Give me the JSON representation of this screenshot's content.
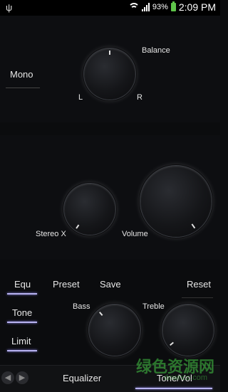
{
  "status": {
    "usb": "ψ",
    "battery_pct": "93%",
    "time": "2:09 PM"
  },
  "balance": {
    "label": "Balance",
    "left": "L",
    "right": "R"
  },
  "mono": {
    "label": "Mono"
  },
  "stereo": {
    "label": "Stereo X"
  },
  "volume": {
    "label": "Volume"
  },
  "sidebar": {
    "items": [
      "Equ",
      "Tone",
      "Limit"
    ]
  },
  "actions": {
    "preset": "Preset",
    "save": "Save",
    "reset": "Reset"
  },
  "tone": {
    "bass": "Bass",
    "treble": "Treble"
  },
  "tabs": [
    "Equalizer",
    "Tone/Vol"
  ],
  "nav": {
    "prev": "◀",
    "next": "▶"
  },
  "watermark": {
    "text": "绿色资源网",
    "url": "downcc.com"
  }
}
